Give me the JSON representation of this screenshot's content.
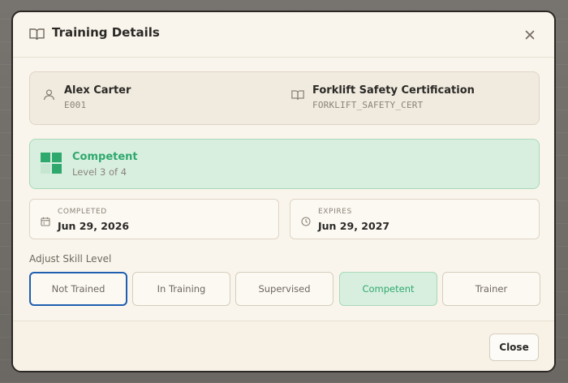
{
  "dialog": {
    "title": "Training Details",
    "close_icon": "close-icon"
  },
  "employee": {
    "name": "Alex Carter",
    "id": "E001",
    "icon": "user-icon"
  },
  "training": {
    "name": "Forklift Safety Certification",
    "code": "FORKLIFT_SAFETY_CERT",
    "icon": "book-icon"
  },
  "level": {
    "name": "Competent",
    "description": "Level 3 of 4",
    "color": "#2fa86d",
    "icon": "level-grid-icon"
  },
  "dates": {
    "completed_label": "COMPLETED",
    "completed_value": "Jun 29, 2026",
    "expires_label": "EXPIRES",
    "expires_value": "Jun 29, 2027"
  },
  "adjust": {
    "label": "Adjust Skill Level",
    "options": [
      "Not Trained",
      "In Training",
      "Supervised",
      "Competent",
      "Trainer"
    ],
    "selected": "Competent",
    "focused": "Not Trained"
  },
  "footer": {
    "close_label": "Close"
  },
  "colors": {
    "accent_green": "#2fa86d",
    "focus_blue": "#1f5fb0",
    "background": "#faf5ec"
  }
}
